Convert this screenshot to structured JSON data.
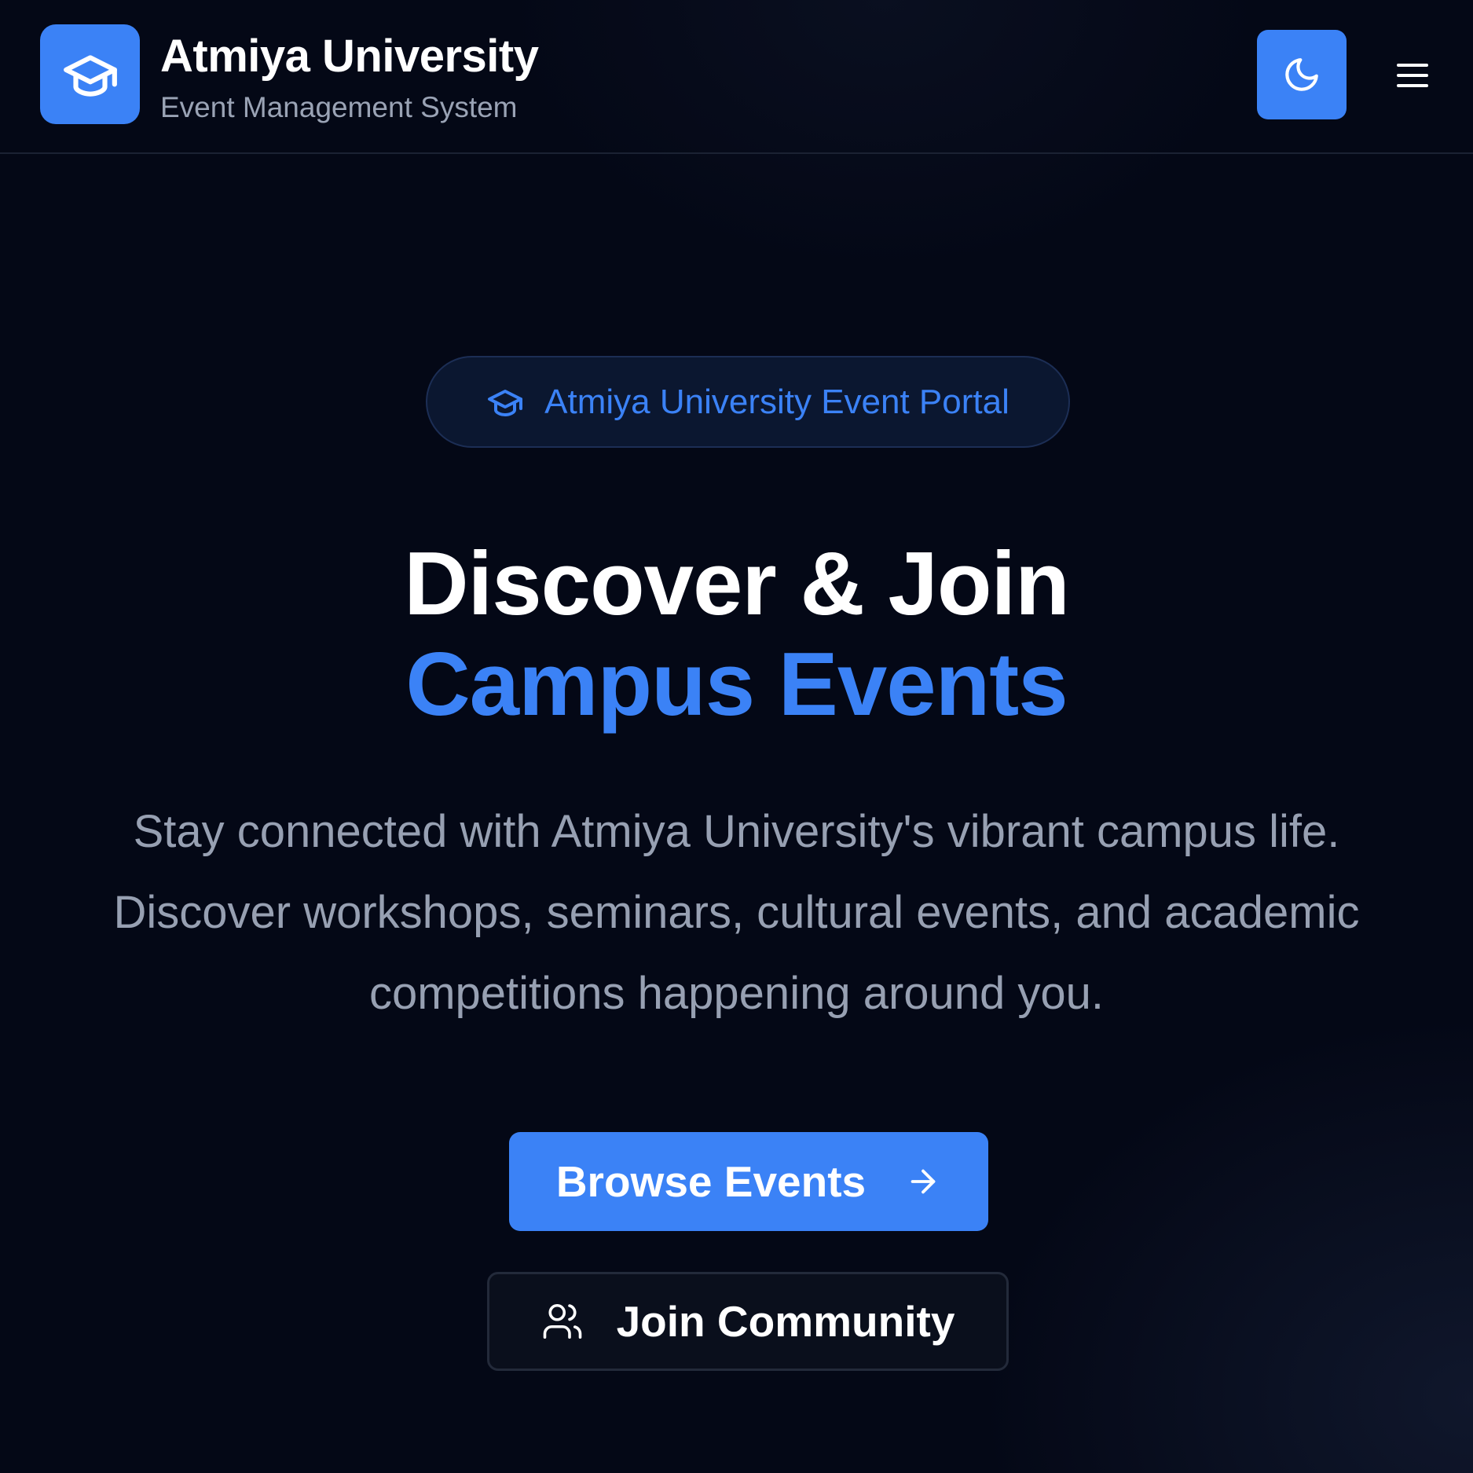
{
  "header": {
    "brand_title": "Atmiya University",
    "brand_subtitle": "Event Management System",
    "logo_icon": "graduation-cap-icon",
    "theme_toggle_icon": "moon-icon",
    "menu_icon": "hamburger-menu-icon"
  },
  "hero": {
    "badge_icon": "graduation-cap-icon",
    "badge_text": "Atmiya University Event Portal",
    "headline_line1": "Discover & Join",
    "headline_line2": "Campus Events",
    "description": "Stay connected with Atmiya University's vibrant campus life. Discover workshops, seminars, cultural events, and academic competitions happening around you."
  },
  "actions": {
    "browse_label": "Browse Events",
    "browse_icon": "arrow-right-icon",
    "community_label": "Join Community",
    "community_icon": "users-icon"
  },
  "colors": {
    "background": "#040816",
    "accent": "#3b82f6",
    "text_primary": "#ffffff",
    "text_muted": "#97a0b2"
  }
}
